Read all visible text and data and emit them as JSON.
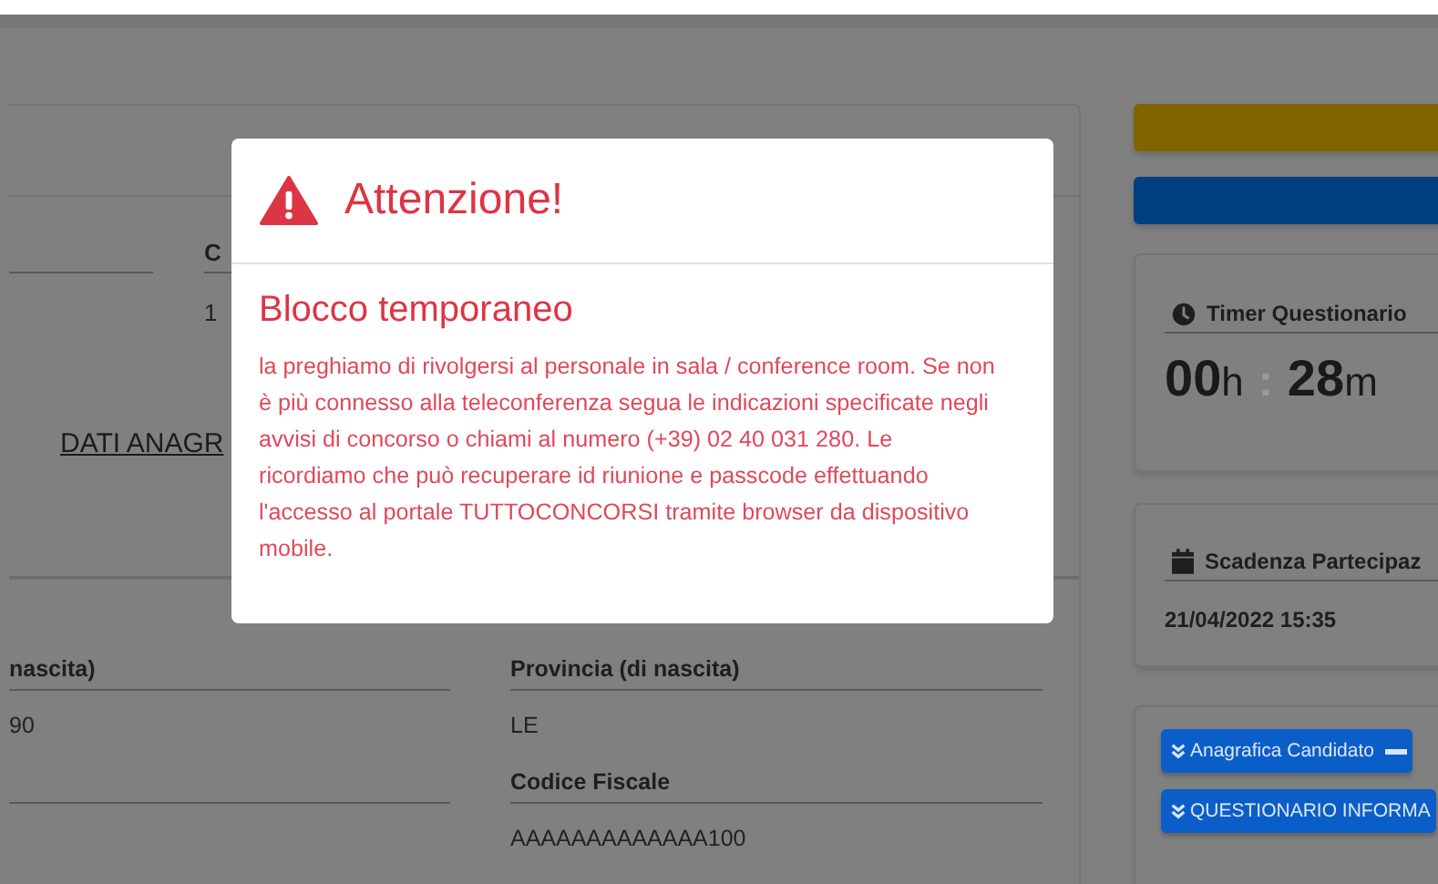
{
  "main_card": {
    "top_fields": [
      {
        "label": "C",
        "value": "1"
      }
    ],
    "section_link": "DATI ANAGR",
    "left_fields": [
      {
        "label": "nascita)",
        "value": "90"
      }
    ],
    "right_fields": [
      {
        "label": "Provincia (di nascita)",
        "value": "LE"
      },
      {
        "label": "Codice Fiscale",
        "value": "AAAAAAAAAAAAA100"
      }
    ]
  },
  "action_bars": [
    {
      "color": "#806400"
    },
    {
      "color": "#003f80"
    }
  ],
  "timer": {
    "title": "Timer Questionario",
    "hours": "00",
    "hours_unit": "h",
    "separator": ":",
    "minutes": "28",
    "minutes_unit": "m"
  },
  "deadline": {
    "title": "Scadenza Partecipaz",
    "value": "21/04/2022 15:35"
  },
  "sections": [
    {
      "label": "Anagrafica Candidato",
      "expanded": true
    },
    {
      "label": "QUESTIONARIO INFORMA",
      "expanded": false
    }
  ],
  "modal": {
    "title": "Attenzione!",
    "heading": "Blocco temporaneo",
    "message": "la preghiamo di rivolgersi al personale in sala / conference room. Se non è più connesso alla teleconferenza segua le indicazioni specificate negli avvisi di concorso o chiami al numero (+39) 02 40 031 280. Le ricordiamo che può recuperare id riunione e passcode effettuando l'accesso al portale TUTTOCONCORSI tramite browser da dispositivo mobile."
  }
}
